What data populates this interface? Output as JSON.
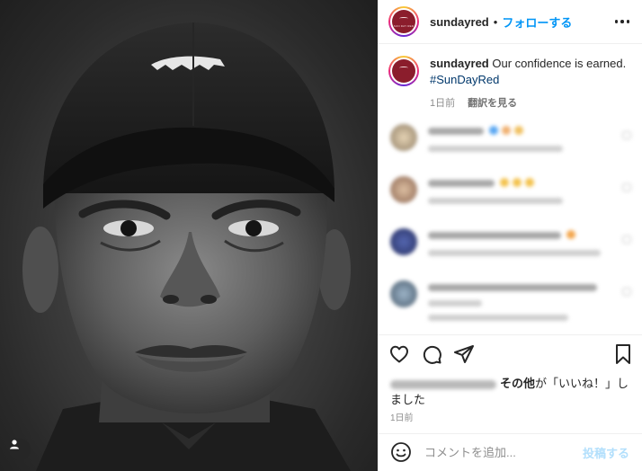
{
  "post": {
    "account": "sundayred",
    "separator": "•",
    "follow_label": "フォローする",
    "avatar_logo_text": "SUN DAY RED"
  },
  "caption": {
    "username": "sundayred",
    "text": " Our confidence is earned.",
    "hashtag": "#SunDayRed",
    "time": "1日前",
    "translate_label": "翻訳を見る"
  },
  "likes": {
    "text_bold": "その他",
    "text_rest": "が「いいね！」しました"
  },
  "post_time": "1日前",
  "comment_box": {
    "placeholder": "コメントを追加...",
    "post_label": "投稿する"
  },
  "colors": {
    "accent": "#0095f6",
    "hashtag": "#00376b",
    "brand": "#8b1d2c",
    "muted": "#8e8e8e"
  },
  "icons": [
    "user-tag-icon",
    "more-options-icon",
    "heart-icon",
    "comment-icon",
    "share-icon",
    "bookmark-icon",
    "emoji-icon"
  ]
}
